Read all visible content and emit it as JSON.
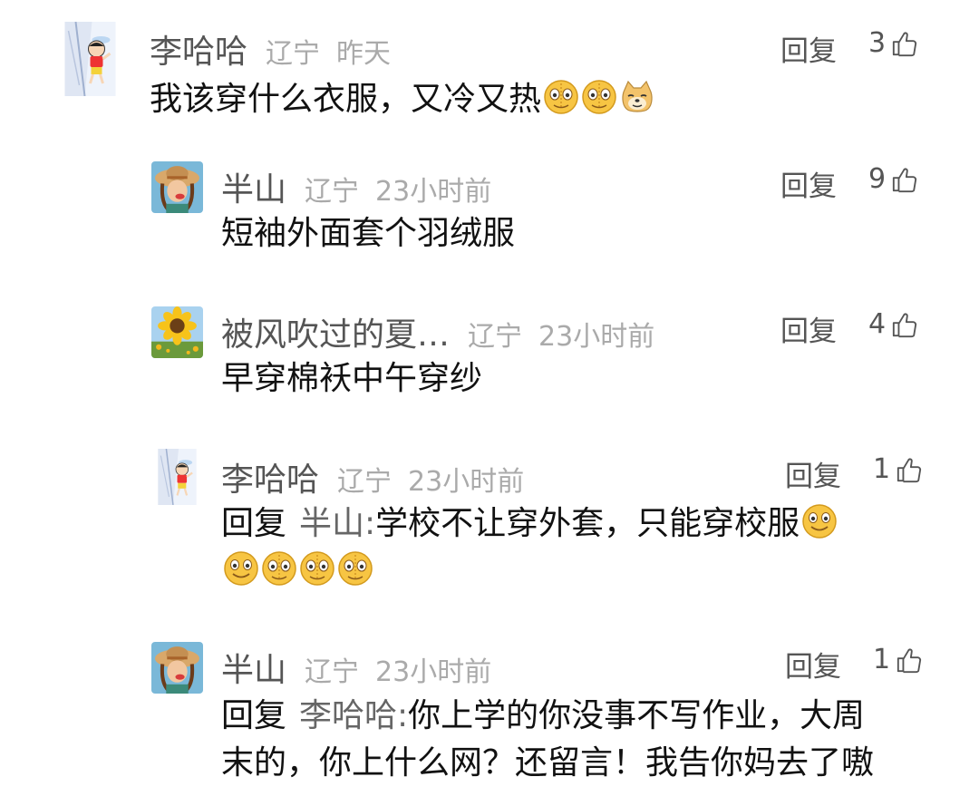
{
  "comments": [
    {
      "name": "李哈哈",
      "location": "辽宁",
      "time": "昨天",
      "reply_label": "回复",
      "likes": "3",
      "text": "我该穿什么衣服，又冷又热",
      "avatar": "crayon-shin-chan-avatar"
    },
    {
      "name": "半山",
      "location": "辽宁",
      "time": "23小时前",
      "reply_label": "回复",
      "likes": "9",
      "text": "短袖外面套个羽绒服",
      "avatar": "straw-hat-girl-avatar"
    },
    {
      "name": "被风吹过的夏…",
      "location": "辽宁",
      "time": "23小时前",
      "reply_label": "回复",
      "likes": "4",
      "text": "早穿棉袄中午穿纱",
      "avatar": "sunflower-avatar"
    },
    {
      "name": "李哈哈",
      "location": "辽宁",
      "time": "23小时前",
      "reply_label": "回复",
      "likes": "1",
      "prefix": "回复",
      "target": "半山:",
      "text": "学校不让穿外套，只能穿校服",
      "avatar": "crayon-shin-chan-avatar"
    },
    {
      "name": "半山",
      "location": "辽宁",
      "time": "23小时前",
      "reply_label": "回复",
      "likes": "1",
      "prefix": "回复",
      "target": "李哈哈:",
      "text_line1": "你上学的你没事不写作业，大周",
      "text_line2": "末的，你上什么网？还留言！我告你妈去了嗷",
      "avatar": "straw-hat-girl-avatar"
    }
  ],
  "icons": {
    "like": "thumbs-up-outline-icon",
    "emoji_sweat": "grin-sweat-emoji",
    "emoji_dog": "doge-emoji",
    "emoji_smile": "smile-emoji"
  },
  "colors": {
    "name": "#555555",
    "meta": "#aaaaaa",
    "text": "#111111"
  }
}
